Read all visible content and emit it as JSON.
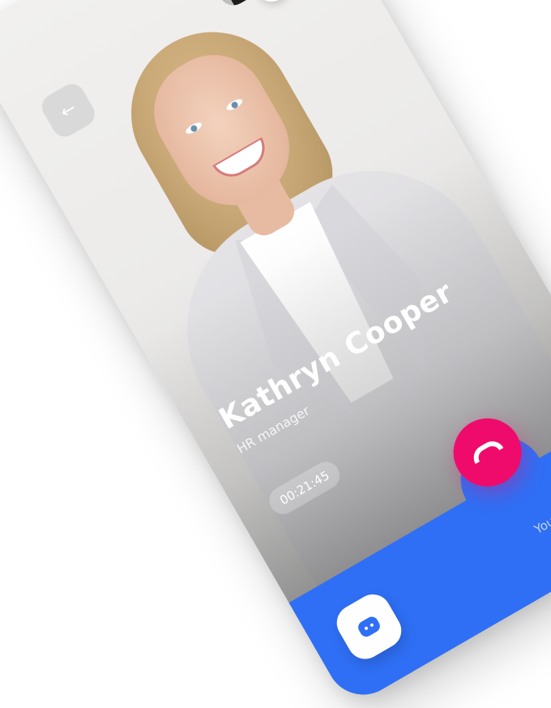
{
  "caller": {
    "name": "Kathryn Cooper",
    "role": "HR manager"
  },
  "call": {
    "duration": "00:21:45",
    "security_note": "Your call is secure"
  },
  "icons": {
    "back": "arrow-left-icon",
    "switch_camera": "camera-switch-icon",
    "hang_up": "phone-hangup-icon",
    "chat": "chat-bubble-icon"
  },
  "colors": {
    "accent": "#2f6ff5",
    "hangup": "#ef0b6b"
  }
}
